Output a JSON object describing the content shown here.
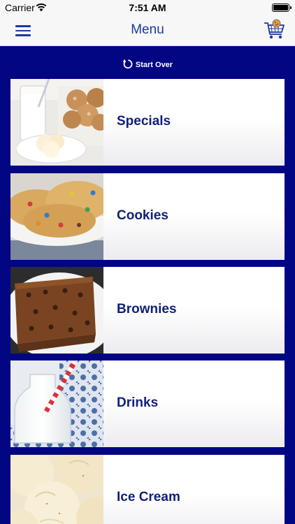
{
  "status_bar": {
    "carrier": "Carrier",
    "time": "7:51 AM"
  },
  "nav": {
    "title": "Menu"
  },
  "start_over": {
    "label": "Start Over"
  },
  "categories": [
    {
      "label": "Specials",
      "image": "milk-and-cookies-photo"
    },
    {
      "label": "Cookies",
      "image": "cookies-photo"
    },
    {
      "label": "Brownies",
      "image": "brownies-photo"
    },
    {
      "label": "Drinks",
      "image": "milk-bottle-photo"
    },
    {
      "label": "Ice Cream",
      "image": "ice-cream-photo"
    }
  ],
  "colors": {
    "background": "#020682",
    "accent": "#1b3aa0",
    "label": "#101f7a"
  }
}
